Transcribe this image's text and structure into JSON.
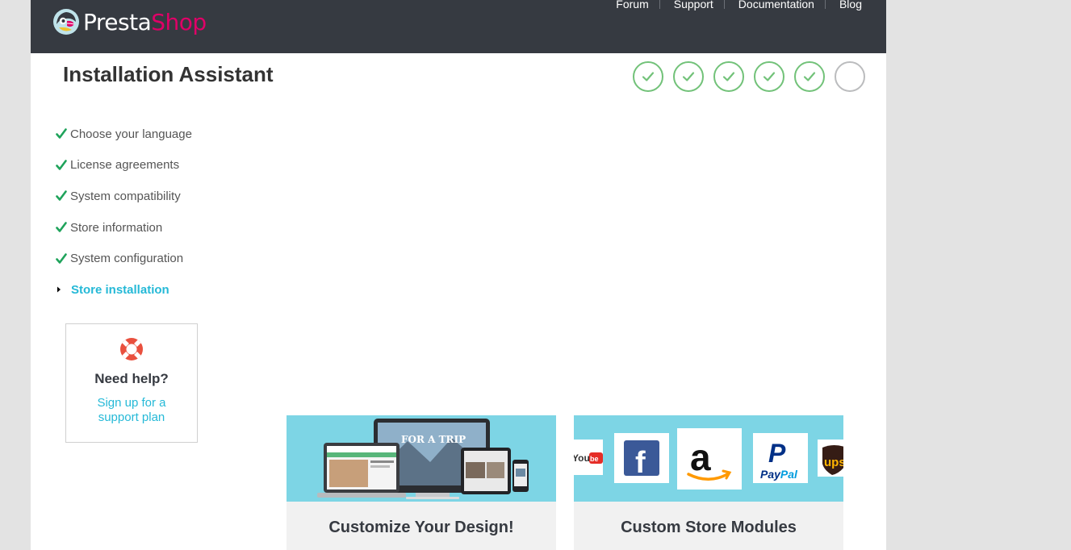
{
  "header": {
    "logo_part1": "Presta",
    "logo_part2": "Shop",
    "nav": [
      "Forum",
      "Support",
      "Documentation",
      "Blog"
    ],
    "logo_icon": "puffin-logo-icon"
  },
  "page_title": "Installation Assistant",
  "progress": {
    "completed": 5,
    "total": 6
  },
  "steps": [
    {
      "label": "Choose your language",
      "state": "done"
    },
    {
      "label": "License agreements",
      "state": "done"
    },
    {
      "label": "System compatibility",
      "state": "done"
    },
    {
      "label": "Store information",
      "state": "done"
    },
    {
      "label": "System configuration",
      "state": "done"
    },
    {
      "label": "Store installation",
      "state": "current"
    }
  ],
  "help": {
    "title": "Need help?",
    "link": "Sign up for a support plan",
    "icon": "lifebuoy-icon"
  },
  "promos": [
    {
      "title": "Customize Your Design!",
      "icon": "devices-mockup-icon"
    },
    {
      "title": "Custom Store Modules",
      "logos": [
        "YouTube",
        "Facebook",
        "Amazon",
        "PayPal",
        "UPS"
      ]
    }
  ],
  "colors": {
    "header_bg": "#363a41",
    "accent_cyan": "#25b9d7",
    "brand_pink": "#df0067",
    "check_green": "#72c279",
    "step_check": "#1fa35b",
    "banner_bg": "#7dd5e5"
  }
}
